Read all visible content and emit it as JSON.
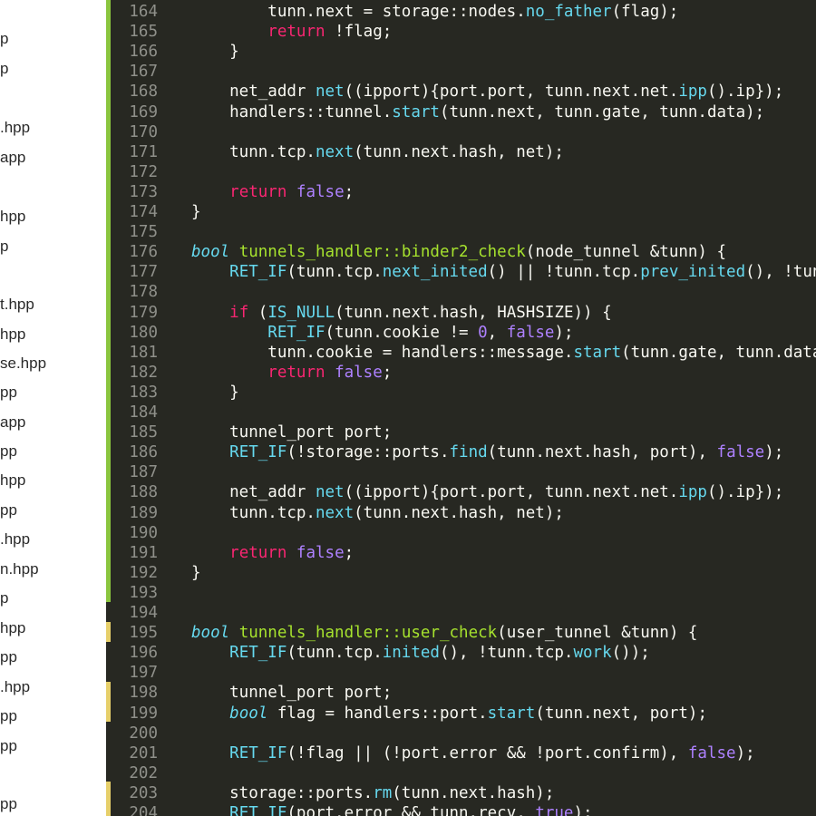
{
  "colors": {
    "background": "#272822",
    "sidebar_background": "#ffffff",
    "gutter_modified": "#8ac53e",
    "gutter_added": "#e6cf6a",
    "line_number": "#8f908a",
    "default_text": "#f8f8f2",
    "keyword": "#f92672",
    "constant": "#ae81ff",
    "function_call": "#66d9ef",
    "type": "#66d9ef",
    "function_name": "#a6e22e"
  },
  "sidebar": {
    "files": [
      "p",
      "p",
      ".hpp",
      "app",
      "hpp",
      "p",
      "t.hpp",
      "hpp",
      "se.hpp",
      "pp",
      "app",
      "pp",
      "hpp",
      "pp",
      ".hpp",
      "n.hpp",
      "p",
      "hpp",
      "pp",
      ".hpp",
      "pp",
      "pp",
      "pp"
    ]
  },
  "editor": {
    "lines": [
      {
        "n": "164",
        "t": [
          [
            "tx",
            "        tunn.next = storage::nodes."
          ],
          [
            "fn",
            "no_father"
          ],
          [
            "tx",
            "(flag);"
          ]
        ]
      },
      {
        "n": "165",
        "t": [
          [
            "tx",
            "        "
          ],
          [
            "kw",
            "return"
          ],
          [
            "tx",
            " !flag;"
          ]
        ]
      },
      {
        "n": "166",
        "t": [
          [
            "tx",
            "    }"
          ]
        ]
      },
      {
        "n": "167",
        "t": []
      },
      {
        "n": "168",
        "t": [
          [
            "tx",
            "    net_addr "
          ],
          [
            "fn",
            "net"
          ],
          [
            "tx",
            "((ipport){port.port, tunn.next.net."
          ],
          [
            "fn",
            "ipp"
          ],
          [
            "tx",
            "().ip});"
          ]
        ]
      },
      {
        "n": "169",
        "t": [
          [
            "tx",
            "    handlers::tunnel."
          ],
          [
            "fn",
            "start"
          ],
          [
            "tx",
            "(tunn.next, tunn.gate, tunn.data);"
          ]
        ]
      },
      {
        "n": "170",
        "t": []
      },
      {
        "n": "171",
        "t": [
          [
            "tx",
            "    tunn.tcp."
          ],
          [
            "fn",
            "next"
          ],
          [
            "tx",
            "(tunn.next.hash, net);"
          ]
        ]
      },
      {
        "n": "172",
        "t": []
      },
      {
        "n": "173",
        "t": [
          [
            "tx",
            "    "
          ],
          [
            "kw",
            "return"
          ],
          [
            "tx",
            " "
          ],
          [
            "cn",
            "false"
          ],
          [
            "tx",
            ";"
          ]
        ]
      },
      {
        "n": "174",
        "t": [
          [
            "tx",
            "}"
          ]
        ]
      },
      {
        "n": "175",
        "t": []
      },
      {
        "n": "176",
        "t": [
          [
            "ty",
            "bool"
          ],
          [
            "tx",
            " "
          ],
          [
            "nm",
            "tunnels_handler::binder2_check"
          ],
          [
            "tx",
            "(node_tunnel &tunn) {"
          ]
        ]
      },
      {
        "n": "177",
        "t": [
          [
            "tx",
            "    "
          ],
          [
            "fn",
            "RET_IF"
          ],
          [
            "tx",
            "(tunn.tcp."
          ],
          [
            "fn",
            "next_inited"
          ],
          [
            "tx",
            "() || !tunn.tcp."
          ],
          [
            "fn",
            "prev_inited"
          ],
          [
            "tx",
            "(), !tunn"
          ]
        ]
      },
      {
        "n": "178",
        "t": []
      },
      {
        "n": "179",
        "t": [
          [
            "tx",
            "    "
          ],
          [
            "kw",
            "if"
          ],
          [
            "tx",
            " ("
          ],
          [
            "fn",
            "IS_NULL"
          ],
          [
            "tx",
            "(tunn.next.hash, HASHSIZE)) {"
          ]
        ]
      },
      {
        "n": "180",
        "t": [
          [
            "tx",
            "        "
          ],
          [
            "fn",
            "RET_IF"
          ],
          [
            "tx",
            "(tunn.cookie != "
          ],
          [
            "cn",
            "0"
          ],
          [
            "tx",
            ", "
          ],
          [
            "cn",
            "false"
          ],
          [
            "tx",
            ");"
          ]
        ]
      },
      {
        "n": "181",
        "t": [
          [
            "tx",
            "        tunn.cookie = handlers::message."
          ],
          [
            "fn",
            "start"
          ],
          [
            "tx",
            "(tunn.gate, tunn.data)"
          ]
        ]
      },
      {
        "n": "182",
        "t": [
          [
            "tx",
            "        "
          ],
          [
            "kw",
            "return"
          ],
          [
            "tx",
            " "
          ],
          [
            "cn",
            "false"
          ],
          [
            "tx",
            ";"
          ]
        ]
      },
      {
        "n": "183",
        "t": [
          [
            "tx",
            "    }"
          ]
        ]
      },
      {
        "n": "184",
        "t": []
      },
      {
        "n": "185",
        "t": [
          [
            "tx",
            "    tunnel_port port;"
          ]
        ]
      },
      {
        "n": "186",
        "t": [
          [
            "tx",
            "    "
          ],
          [
            "fn",
            "RET_IF"
          ],
          [
            "tx",
            "(!storage::ports."
          ],
          [
            "fn",
            "find"
          ],
          [
            "tx",
            "(tunn.next.hash, port), "
          ],
          [
            "cn",
            "false"
          ],
          [
            "tx",
            ");"
          ]
        ]
      },
      {
        "n": "187",
        "t": []
      },
      {
        "n": "188",
        "t": [
          [
            "tx",
            "    net_addr "
          ],
          [
            "fn",
            "net"
          ],
          [
            "tx",
            "((ipport){port.port, tunn.next.net."
          ],
          [
            "fn",
            "ipp"
          ],
          [
            "tx",
            "().ip});"
          ]
        ]
      },
      {
        "n": "189",
        "t": [
          [
            "tx",
            "    tunn.tcp."
          ],
          [
            "fn",
            "next"
          ],
          [
            "tx",
            "(tunn.next.hash, net);"
          ]
        ]
      },
      {
        "n": "190",
        "t": []
      },
      {
        "n": "191",
        "t": [
          [
            "tx",
            "    "
          ],
          [
            "kw",
            "return"
          ],
          [
            "tx",
            " "
          ],
          [
            "cn",
            "false"
          ],
          [
            "tx",
            ";"
          ]
        ]
      },
      {
        "n": "192",
        "t": [
          [
            "tx",
            "}"
          ]
        ]
      },
      {
        "n": "193",
        "t": []
      },
      {
        "n": "194",
        "t": []
      },
      {
        "n": "195",
        "t": [
          [
            "ty",
            "bool"
          ],
          [
            "tx",
            " "
          ],
          [
            "nm",
            "tunnels_handler::user_check"
          ],
          [
            "tx",
            "(user_tunnel &tunn) {"
          ]
        ]
      },
      {
        "n": "196",
        "t": [
          [
            "tx",
            "    "
          ],
          [
            "fn",
            "RET_IF"
          ],
          [
            "tx",
            "(tunn.tcp."
          ],
          [
            "fn",
            "inited"
          ],
          [
            "tx",
            "(), !tunn.tcp."
          ],
          [
            "fn",
            "work"
          ],
          [
            "tx",
            "());"
          ]
        ]
      },
      {
        "n": "197",
        "t": []
      },
      {
        "n": "198",
        "t": [
          [
            "tx",
            "    tunnel_port port;"
          ]
        ]
      },
      {
        "n": "199",
        "t": [
          [
            "tx",
            "    "
          ],
          [
            "ty",
            "bool"
          ],
          [
            "tx",
            " flag = handlers::port."
          ],
          [
            "fn",
            "start"
          ],
          [
            "tx",
            "(tunn.next, port);"
          ]
        ]
      },
      {
        "n": "200",
        "t": []
      },
      {
        "n": "201",
        "t": [
          [
            "tx",
            "    "
          ],
          [
            "fn",
            "RET_IF"
          ],
          [
            "tx",
            "(!flag || (!port.error && !port.confirm), "
          ],
          [
            "cn",
            "false"
          ],
          [
            "tx",
            ");"
          ]
        ]
      },
      {
        "n": "202",
        "t": []
      },
      {
        "n": "203",
        "t": [
          [
            "tx",
            "    storage::ports."
          ],
          [
            "fn",
            "rm"
          ],
          [
            "tx",
            "(tunn.next.hash);"
          ]
        ]
      },
      {
        "n": "204",
        "t": [
          [
            "tx",
            "    "
          ],
          [
            "fn",
            "RET_IF"
          ],
          [
            "tx",
            "(port.error && tunn.recv, "
          ],
          [
            "cn",
            "true"
          ],
          [
            "tx",
            ");"
          ]
        ]
      }
    ]
  }
}
